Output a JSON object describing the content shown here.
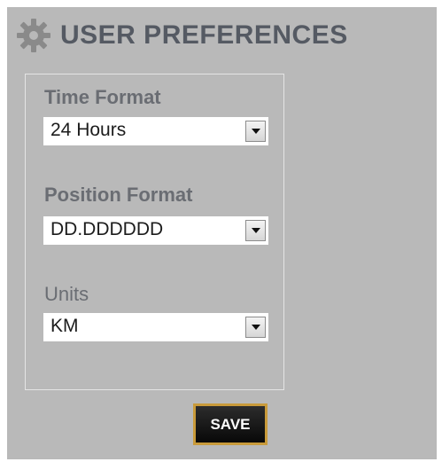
{
  "header": {
    "title": "USER PREFERENCES",
    "icon": "gear-icon"
  },
  "fields": {
    "time_format": {
      "label": "Time Format",
      "value": "24 Hours"
    },
    "position_format": {
      "label": "Position Format",
      "value": "DD.DDDDDD"
    },
    "units": {
      "label": "Units",
      "value": "KM"
    }
  },
  "actions": {
    "save_label": "SAVE"
  },
  "colors": {
    "panel_background": "#b9b9b9",
    "title_text": "#555a63",
    "button_border": "#c89a3a",
    "button_background": "#111111"
  }
}
